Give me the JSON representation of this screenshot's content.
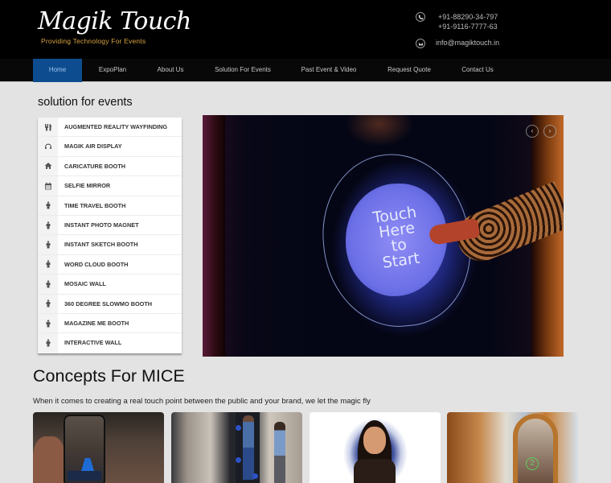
{
  "header": {
    "logo_text": "Magik Touch",
    "tagline": "Providing Technology For Events",
    "phone_icon": "phone-icon",
    "phones": [
      "+91-88290-34-797",
      "+91-9116-7777-63"
    ],
    "email_icon": "envelope-icon",
    "email": "info@magiktouch.in"
  },
  "nav": {
    "items": [
      {
        "label": "Home",
        "active": true
      },
      {
        "label": "ExpoPlan",
        "active": false
      },
      {
        "label": "About Us",
        "active": false
      },
      {
        "label": "Solution For Events",
        "active": false
      },
      {
        "label": "Past Event & Video",
        "active": false
      },
      {
        "label": "Request Quote",
        "active": false
      },
      {
        "label": "Contact Us",
        "active": false
      }
    ],
    "active_color": "#0d4d8f"
  },
  "sidebar": {
    "title": "solution for events",
    "items": [
      {
        "label": "AUGMENTED REALITY WAYFINDING",
        "icon": "cutlery-icon"
      },
      {
        "label": "MAGIK AIR DISPLAY",
        "icon": "headphones-icon"
      },
      {
        "label": "CARICATURE BOOTH",
        "icon": "home-icon"
      },
      {
        "label": "SELFIE MIRROR",
        "icon": "calendar-icon"
      },
      {
        "label": "TIME TRAVEL BOOTH",
        "icon": "person-icon"
      },
      {
        "label": "INSTANT PHOTO MAGNET",
        "icon": "person-icon"
      },
      {
        "label": "INSTANT SKETCH BOOTH",
        "icon": "person-icon"
      },
      {
        "label": "WORD CLOUD BOOTH",
        "icon": "person-icon"
      },
      {
        "label": "MOSAIC WALL",
        "icon": "person-icon"
      },
      {
        "label": "360 DEGREE SLOWMO BOOTH",
        "icon": "person-icon"
      },
      {
        "label": "MAGAZINE ME BOOTH",
        "icon": "person-icon"
      },
      {
        "label": "INTERACTIVE WALL",
        "icon": "person-icon"
      }
    ]
  },
  "slider": {
    "screen_text": [
      "Touch",
      "Here",
      "to",
      "Start"
    ],
    "prev_glyph": "‹",
    "next_glyph": "›"
  },
  "concepts": {
    "title": "Concepts For MICE",
    "subtitle": "When it comes to creating a real touch point between the public and your brand, we let the magic fly",
    "cards": [
      {
        "subject": "AR wayfinding phone"
      },
      {
        "subject": "Magik air display"
      },
      {
        "subject": "Caricature"
      },
      {
        "subject": "Selfie mirror",
        "badge": "2"
      }
    ]
  }
}
